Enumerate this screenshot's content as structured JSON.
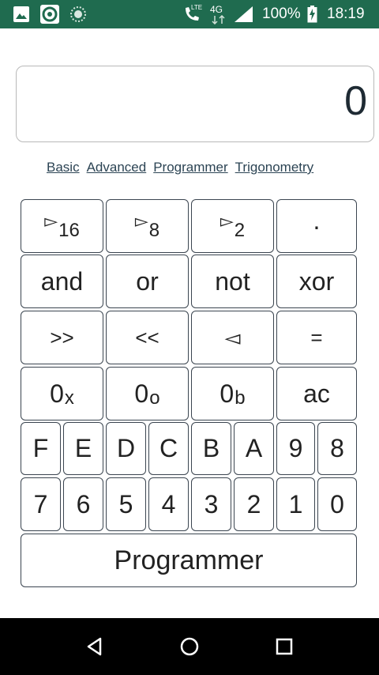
{
  "status": {
    "lte": "LTE",
    "network": "4G",
    "battery": "100%",
    "time": "18:19"
  },
  "display": {
    "value": "0"
  },
  "modes": [
    "Basic",
    "Advanced",
    "Programmer",
    "Trigonometry"
  ],
  "keys": {
    "to_hex": {
      "arrow": "▻",
      "sub": "16"
    },
    "to_oct": {
      "arrow": "▻",
      "sub": "8"
    },
    "to_bin": {
      "arrow": "▻",
      "sub": "2"
    },
    "dot": "·",
    "and": "and",
    "or": "or",
    "not": "not",
    "xor": "xor",
    "shr": ">>",
    "shl": "<<",
    "back": "◅",
    "equals": "=",
    "prefix_hex": {
      "base": "0",
      "sub": "x"
    },
    "prefix_oct": {
      "base": "0",
      "sub": "o"
    },
    "prefix_bin": {
      "base": "0",
      "sub": "b"
    },
    "ac": "ac",
    "hex_digits": [
      "F",
      "E",
      "D",
      "C",
      "B",
      "A",
      "9",
      "8"
    ],
    "digits": [
      "7",
      "6",
      "5",
      "4",
      "3",
      "2",
      "1",
      "0"
    ],
    "mode_button": "Programmer"
  }
}
